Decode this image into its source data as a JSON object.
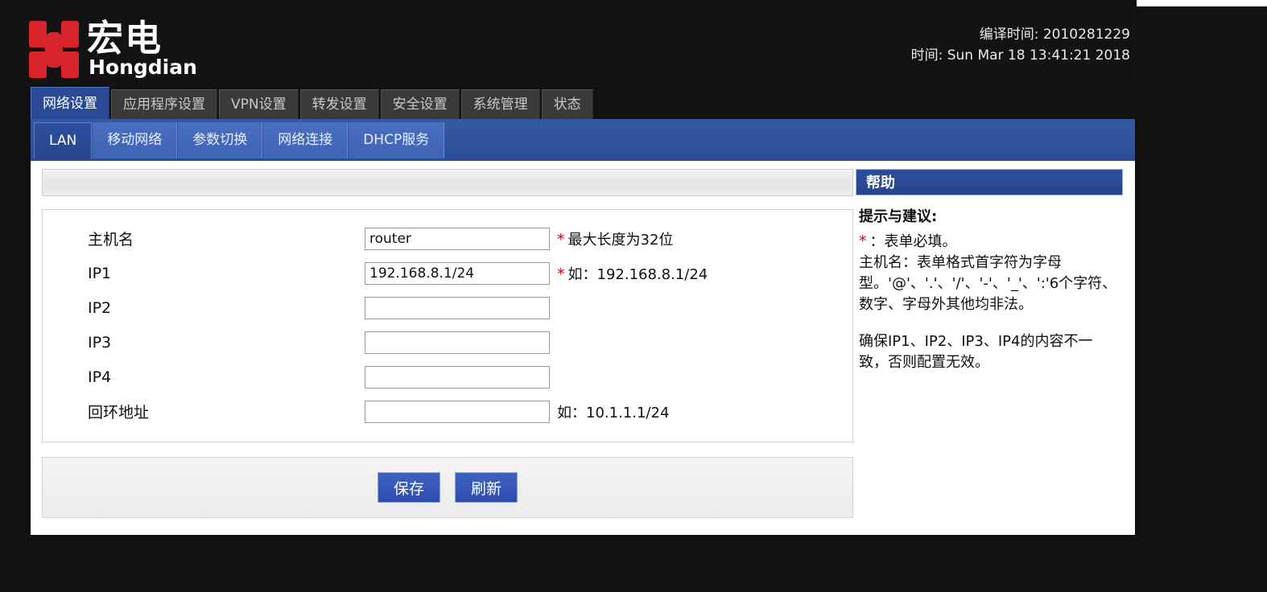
{
  "header": {
    "logo_cn": "宏电",
    "logo_en": "Hongdian",
    "build_time": "编译时间: 2010281229",
    "current_time": "时间: Sun Mar 18 13:41:21 2018"
  },
  "main_tabs": [
    {
      "label": "网络设置",
      "active": true
    },
    {
      "label": "应用程序设置",
      "active": false
    },
    {
      "label": "VPN设置",
      "active": false
    },
    {
      "label": "转发设置",
      "active": false
    },
    {
      "label": "安全设置",
      "active": false
    },
    {
      "label": "系统管理",
      "active": false
    },
    {
      "label": "状态",
      "active": false
    }
  ],
  "sub_tabs": [
    {
      "label": "LAN",
      "active": true
    },
    {
      "label": "移动网络",
      "active": false
    },
    {
      "label": "参数切换",
      "active": false
    },
    {
      "label": "网络连接",
      "active": false
    },
    {
      "label": "DHCP服务",
      "active": false
    }
  ],
  "panel": {
    "title": ""
  },
  "form": {
    "rows": [
      {
        "label": "主机名",
        "value": "router",
        "placeholder": "",
        "required": true,
        "hint": "最大长度为32位"
      },
      {
        "label": "IP1",
        "value": "192.168.8.1/24",
        "placeholder": "",
        "required": true,
        "hint": "如：192.168.8.1/24"
      },
      {
        "label": "IP2",
        "value": "",
        "placeholder": "",
        "required": false,
        "hint": ""
      },
      {
        "label": "IP3",
        "value": "",
        "placeholder": "",
        "required": false,
        "hint": ""
      },
      {
        "label": "IP4",
        "value": "",
        "placeholder": "",
        "required": false,
        "hint": ""
      },
      {
        "label": "回环地址",
        "value": "",
        "placeholder": "",
        "required": false,
        "hint": "如：10.1.1.1/24"
      }
    ]
  },
  "buttons": {
    "save": "保存",
    "refresh": "刷新"
  },
  "help": {
    "title": "帮助",
    "heading": "提示与建议:",
    "star": "*",
    "line_required": "：表单必填。",
    "line_hostname": "主机名：表单格式首字符为字母型。'@'、'.'、'/'、'-'、'_'、':'6个字符、数字、字母外其他均非法。",
    "line_ip": "确保IP1、IP2、IP3、IP4的内容不一致，否则配置无效。"
  },
  "colors": {
    "accent_blue": "#2a4a96",
    "subtab_blue": "#2f55a7",
    "logo_red": "#d8232a",
    "required_red": "#d0021b",
    "header_dark": "#131313"
  }
}
